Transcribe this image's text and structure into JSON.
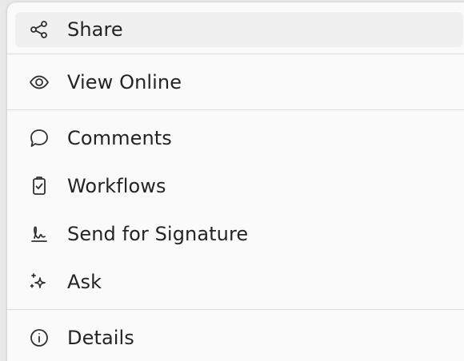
{
  "menu": {
    "items": [
      {
        "label": "Share",
        "icon": "share-icon"
      },
      {
        "label": "View Online",
        "icon": "eye-icon"
      },
      {
        "label": "Comments",
        "icon": "comment-bubble-icon"
      },
      {
        "label": "Workflows",
        "icon": "clipboard-check-icon"
      },
      {
        "label": "Send for Signature",
        "icon": "signature-icon"
      },
      {
        "label": "Ask",
        "icon": "sparkle-icon"
      },
      {
        "label": "Details",
        "icon": "info-icon"
      }
    ]
  },
  "colors": {
    "menu_background": "#fafafa",
    "selected_background": "#f0f0f0",
    "text": "#242424",
    "divider": "#dddddd",
    "icon_stroke": "#303030"
  }
}
